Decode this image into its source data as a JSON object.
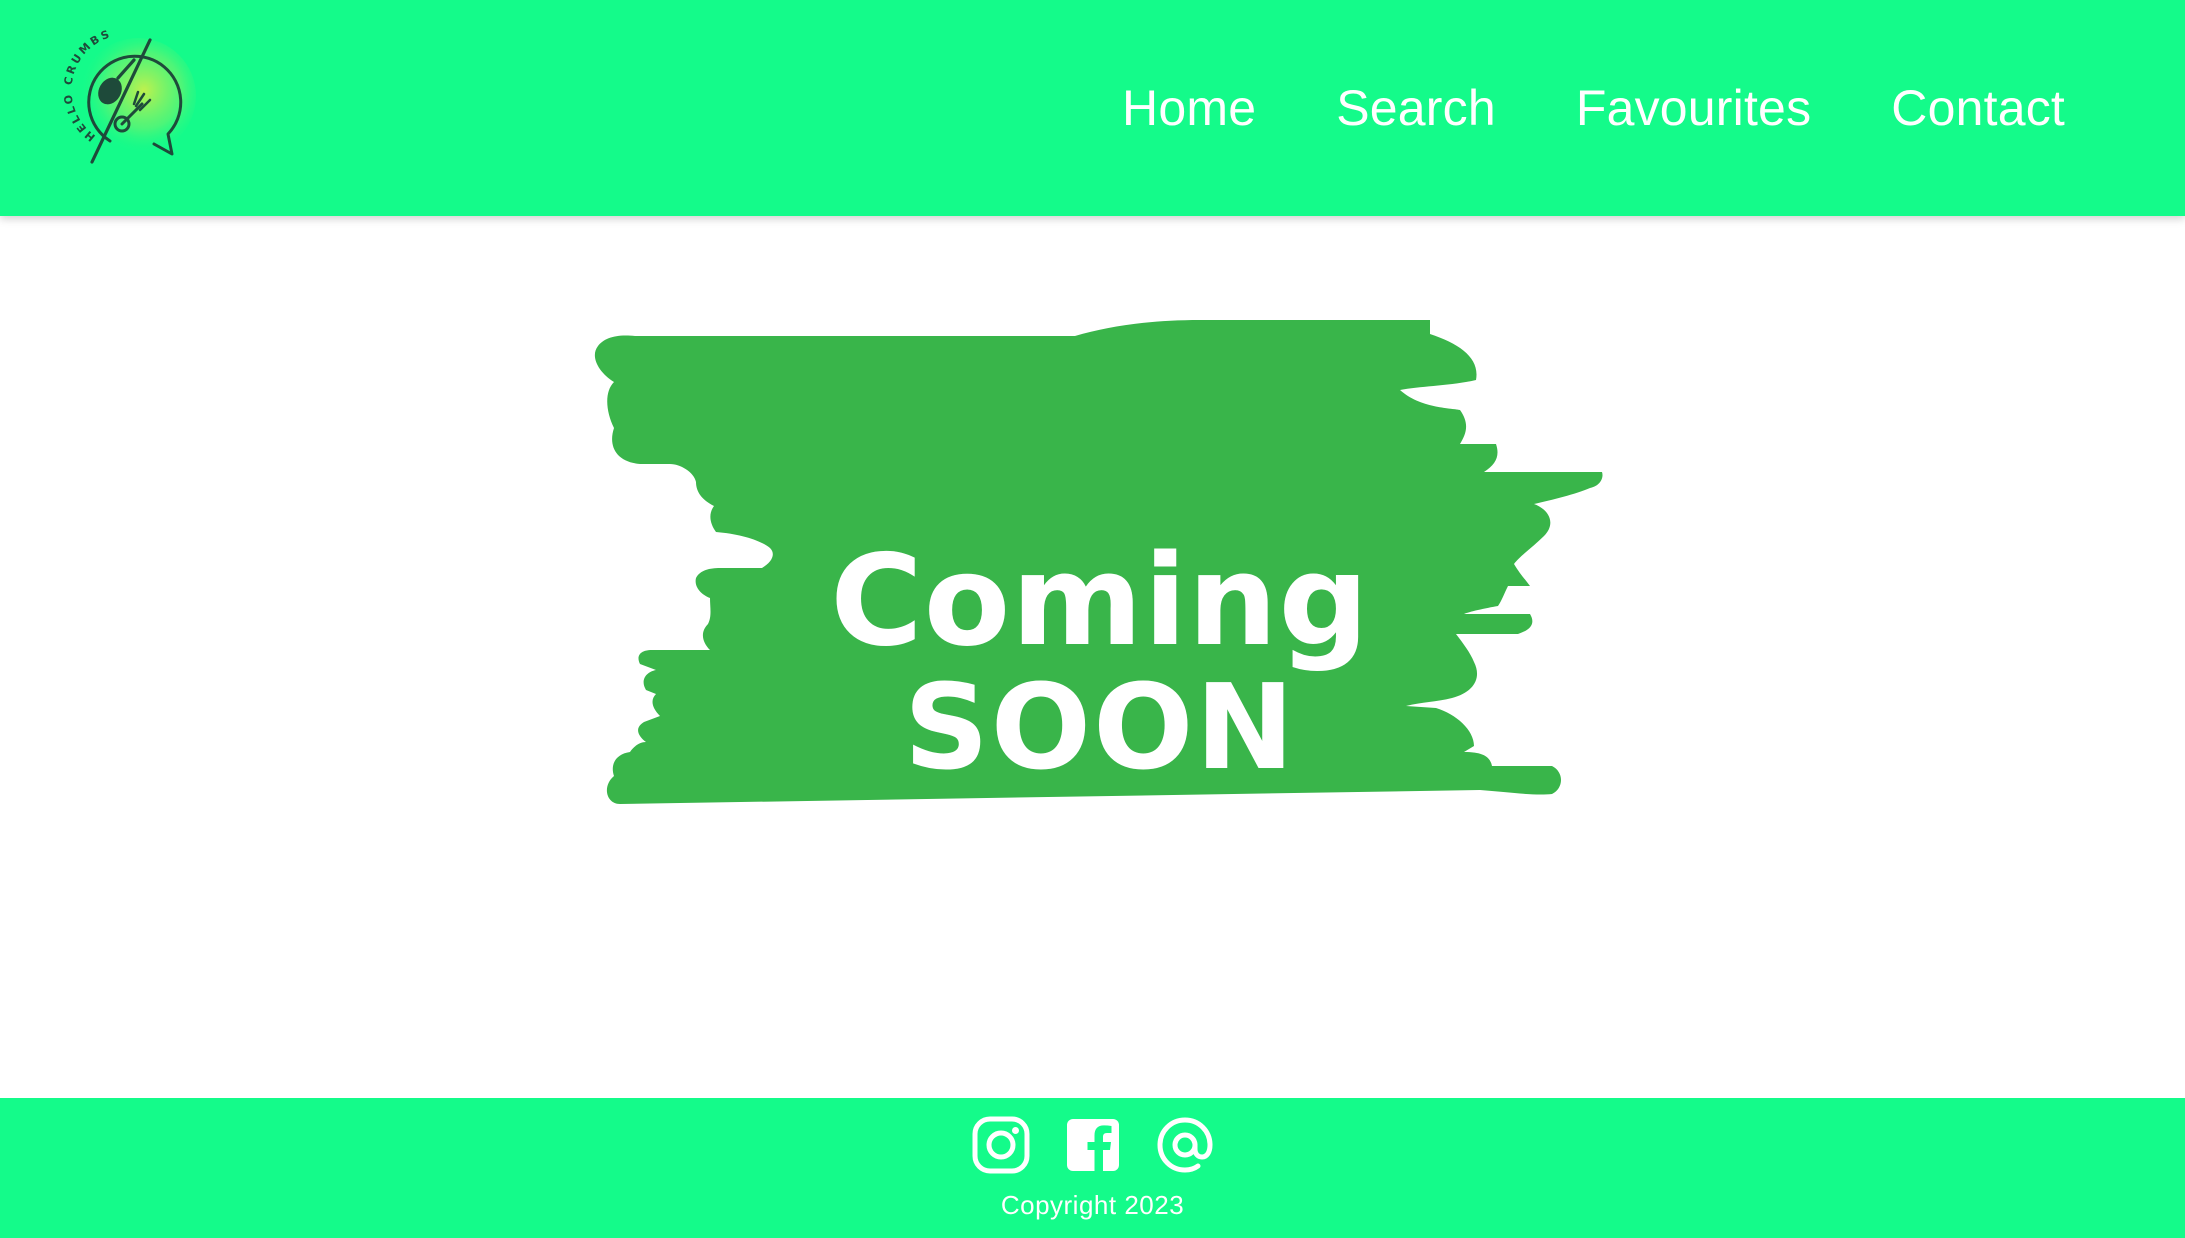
{
  "brand": {
    "logo_text": "HELLO CRUMBS",
    "logo_icon": "crumbs-logo-icon"
  },
  "nav": {
    "items": [
      {
        "label": "Home"
      },
      {
        "label": "Search"
      },
      {
        "label": "Favourites"
      },
      {
        "label": "Contact"
      }
    ]
  },
  "main": {
    "banner": {
      "line1": "Coming",
      "line2": "SOON",
      "color": "#39b54a"
    }
  },
  "footer": {
    "socials": [
      {
        "icon": "instagram-icon"
      },
      {
        "icon": "facebook-icon"
      },
      {
        "icon": "email-at-icon"
      }
    ],
    "copyright": "Copyright 2023"
  },
  "colors": {
    "header_bg": "#14fb8a",
    "footer_bg": "#14fb8a",
    "text_on_green": "#ffffff",
    "banner_green": "#39b54a",
    "logo_stroke": "#1e4a3a"
  }
}
